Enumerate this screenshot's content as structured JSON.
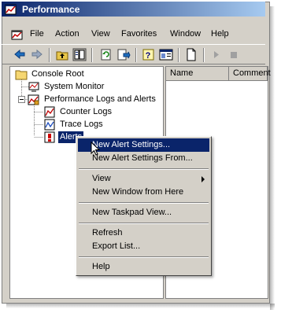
{
  "window": {
    "title": "Performance"
  },
  "menubar": {
    "file": "File",
    "action": "Action",
    "view": "View",
    "favorites": "Favorites",
    "window": "Window",
    "help": "Help"
  },
  "tree": {
    "console_root": "Console Root",
    "system_monitor": "System Monitor",
    "perf_logs": "Performance Logs and Alerts",
    "counter_logs": "Counter Logs",
    "trace_logs": "Trace Logs",
    "alerts": "Alerts",
    "expander_minus": "−"
  },
  "list": {
    "columns": [
      "Name",
      "Comment"
    ]
  },
  "context_menu": {
    "items": [
      "New Alert Settings...",
      "New Alert Settings From...",
      "View",
      "New Window from Here",
      "New Taskpad View...",
      "Refresh",
      "Export List...",
      "Help"
    ],
    "highlighted": "New Alert Settings..."
  },
  "colors": {
    "title_start": "#0a246a",
    "title_end": "#a6caf0",
    "selection": "#0a246a",
    "face": "#d4d0c8"
  },
  "icons": [
    "app-icon",
    "mmc-icon",
    "back-icon",
    "forward-icon",
    "up-icon",
    "show-tree-icon",
    "refresh-icon",
    "export-icon",
    "help-icon",
    "properties-icon",
    "new-icon",
    "play-icon",
    "stop-icon"
  ]
}
